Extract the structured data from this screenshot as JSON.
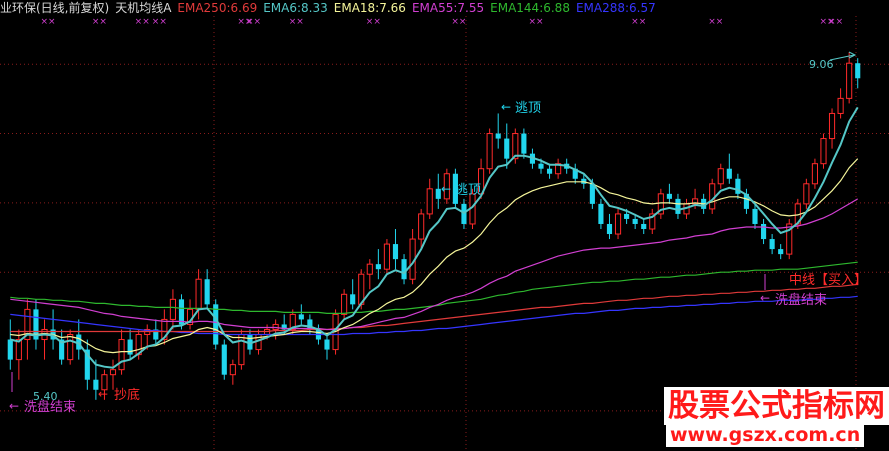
{
  "header": {
    "title": "业环保(日线,前复权)",
    "indicator": "天机均线A",
    "ema250": "EMA250:6.69",
    "ema6": "EMA6:8.33",
    "ema18": "EMA18:7.66",
    "ema55": "EMA55:7.55",
    "ema144": "EMA144:6.88",
    "ema288": "EMA288:6.57"
  },
  "annotations": {
    "high_price": "9.06",
    "low_price": "5.40",
    "escape_top_1": "逃顶",
    "escape_top_2": "逃顶",
    "buy_bottom": "抄底",
    "washout_end_1": "洗盘结束",
    "washout_end_2": "洗盘结束",
    "mid_line": "中线【买入】",
    "cross_mark": "×"
  },
  "watermark": {
    "line1": "股票公式指标网",
    "line2": "www.gszx.com.cn"
  },
  "colors": {
    "background": "#000000",
    "up": "#ff2a2a",
    "down": "#21d6ee",
    "ema6": "#55c7c7",
    "ema18": "#f5f59a",
    "ema55": "#d13fd1",
    "ema144": "#2eb82e",
    "ema250": "#e03a3a",
    "ema288": "#3535ff",
    "grid": "#8a1c1c"
  },
  "chart_data": {
    "type": "candlestick",
    "ylim": [
      5.2,
      9.4
    ],
    "y_gridlines": [
      5.49,
      6.87,
      7.56,
      8.25,
      8.94
    ],
    "ohlc": [
      [
        6.2,
        6.4,
        5.9,
        6.0
      ],
      [
        6.0,
        6.3,
        5.8,
        6.2
      ],
      [
        6.2,
        6.6,
        6.0,
        6.5
      ],
      [
        6.5,
        6.6,
        6.1,
        6.2
      ],
      [
        6.2,
        6.4,
        6.0,
        6.3
      ],
      [
        6.3,
        6.5,
        6.1,
        6.2
      ],
      [
        6.2,
        6.3,
        5.95,
        6.0
      ],
      [
        6.0,
        6.3,
        5.95,
        6.25
      ],
      [
        6.25,
        6.4,
        6.0,
        6.1
      ],
      [
        6.1,
        6.2,
        5.7,
        5.8
      ],
      [
        5.8,
        6.0,
        5.6,
        5.7
      ],
      [
        5.7,
        5.9,
        5.6,
        5.85
      ],
      [
        5.85,
        6.0,
        5.7,
        5.9
      ],
      [
        5.9,
        6.3,
        5.85,
        6.2
      ],
      [
        6.2,
        6.3,
        6.0,
        6.05
      ],
      [
        6.05,
        6.3,
        6.0,
        6.25
      ],
      [
        6.25,
        6.35,
        6.1,
        6.3
      ],
      [
        6.3,
        6.4,
        6.15,
        6.2
      ],
      [
        6.2,
        6.5,
        6.15,
        6.4
      ],
      [
        6.4,
        6.7,
        6.3,
        6.6
      ],
      [
        6.6,
        6.65,
        6.3,
        6.35
      ],
      [
        6.35,
        6.6,
        6.3,
        6.5
      ],
      [
        6.5,
        6.9,
        6.4,
        6.8
      ],
      [
        6.8,
        6.9,
        6.5,
        6.55
      ],
      [
        6.55,
        6.6,
        6.1,
        6.15
      ],
      [
        6.15,
        6.2,
        5.8,
        5.85
      ],
      [
        5.85,
        6.0,
        5.75,
        5.95
      ],
      [
        5.95,
        6.3,
        5.9,
        6.25
      ],
      [
        6.25,
        6.3,
        6.05,
        6.1
      ],
      [
        6.1,
        6.3,
        6.05,
        6.25
      ],
      [
        6.25,
        6.35,
        6.2,
        6.3
      ],
      [
        6.3,
        6.4,
        6.2,
        6.35
      ],
      [
        6.35,
        6.45,
        6.25,
        6.3
      ],
      [
        6.3,
        6.5,
        6.25,
        6.45
      ],
      [
        6.45,
        6.55,
        6.35,
        6.4
      ],
      [
        6.4,
        6.45,
        6.25,
        6.3
      ],
      [
        6.3,
        6.35,
        6.15,
        6.2
      ],
      [
        6.2,
        6.25,
        6.0,
        6.1
      ],
      [
        6.1,
        6.5,
        6.05,
        6.45
      ],
      [
        6.45,
        6.7,
        6.4,
        6.65
      ],
      [
        6.65,
        6.8,
        6.5,
        6.55
      ],
      [
        6.55,
        6.9,
        6.5,
        6.85
      ],
      [
        6.85,
        7.0,
        6.7,
        6.95
      ],
      [
        6.95,
        7.1,
        6.8,
        6.9
      ],
      [
        6.9,
        7.2,
        6.85,
        7.15
      ],
      [
        7.15,
        7.3,
        6.9,
        7.0
      ],
      [
        7.0,
        7.05,
        6.75,
        6.8
      ],
      [
        6.8,
        7.3,
        6.75,
        7.2
      ],
      [
        7.2,
        7.5,
        7.1,
        7.45
      ],
      [
        7.45,
        7.8,
        7.4,
        7.7
      ],
      [
        7.7,
        7.85,
        7.5,
        7.6
      ],
      [
        7.6,
        7.9,
        7.55,
        7.85
      ],
      [
        7.85,
        7.9,
        7.5,
        7.55
      ],
      [
        7.55,
        7.6,
        7.3,
        7.35
      ],
      [
        7.35,
        7.7,
        7.3,
        7.65
      ],
      [
        7.65,
        8.0,
        7.6,
        7.9
      ],
      [
        7.9,
        8.3,
        7.85,
        8.25
      ],
      [
        8.25,
        8.45,
        8.1,
        8.2
      ],
      [
        8.2,
        8.35,
        7.9,
        8.0
      ],
      [
        8.0,
        8.3,
        7.95,
        8.25
      ],
      [
        8.25,
        8.3,
        8.0,
        8.05
      ],
      [
        8.05,
        8.1,
        7.9,
        7.95
      ],
      [
        7.95,
        8.0,
        7.85,
        7.9
      ],
      [
        7.9,
        7.95,
        7.8,
        7.85
      ],
      [
        7.85,
        8.0,
        7.8,
        7.95
      ],
      [
        7.95,
        8.0,
        7.85,
        7.9
      ],
      [
        7.9,
        7.95,
        7.75,
        7.8
      ],
      [
        7.8,
        7.85,
        7.7,
        7.75
      ],
      [
        7.75,
        7.8,
        7.5,
        7.55
      ],
      [
        7.55,
        7.6,
        7.3,
        7.35
      ],
      [
        7.35,
        7.45,
        7.2,
        7.25
      ],
      [
        7.25,
        7.5,
        7.2,
        7.45
      ],
      [
        7.45,
        7.5,
        7.35,
        7.4
      ],
      [
        7.4,
        7.45,
        7.3,
        7.35
      ],
      [
        7.35,
        7.4,
        7.25,
        7.3
      ],
      [
        7.3,
        7.5,
        7.25,
        7.45
      ],
      [
        7.45,
        7.7,
        7.4,
        7.65
      ],
      [
        7.65,
        7.75,
        7.55,
        7.6
      ],
      [
        7.6,
        7.65,
        7.4,
        7.45
      ],
      [
        7.45,
        7.6,
        7.4,
        7.55
      ],
      [
        7.55,
        7.7,
        7.5,
        7.6
      ],
      [
        7.6,
        7.65,
        7.45,
        7.5
      ],
      [
        7.5,
        7.8,
        7.45,
        7.75
      ],
      [
        7.75,
        7.95,
        7.7,
        7.9
      ],
      [
        7.9,
        8.05,
        7.75,
        7.8
      ],
      [
        7.8,
        7.85,
        7.6,
        7.65
      ],
      [
        7.65,
        7.7,
        7.45,
        7.5
      ],
      [
        7.5,
        7.55,
        7.3,
        7.35
      ],
      [
        7.35,
        7.4,
        7.15,
        7.2
      ],
      [
        7.2,
        7.25,
        7.05,
        7.1
      ],
      [
        7.1,
        7.15,
        7.0,
        7.05
      ],
      [
        7.05,
        7.4,
        7.0,
        7.35
      ],
      [
        7.35,
        7.6,
        7.3,
        7.55
      ],
      [
        7.55,
        7.8,
        7.5,
        7.75
      ],
      [
        7.75,
        8.0,
        7.7,
        7.95
      ],
      [
        7.95,
        8.25,
        7.9,
        8.2
      ],
      [
        8.2,
        8.5,
        8.1,
        8.45
      ],
      [
        8.45,
        8.7,
        8.4,
        8.6
      ],
      [
        8.6,
        9.06,
        8.55,
        8.95
      ],
      [
        8.95,
        9.0,
        8.7,
        8.8
      ]
    ],
    "ema6": [
      6.2,
      6.18,
      6.25,
      6.24,
      6.25,
      6.24,
      6.17,
      6.19,
      6.16,
      6.05,
      5.95,
      5.93,
      5.92,
      5.98,
      6.0,
      6.06,
      6.13,
      6.15,
      6.22,
      6.33,
      6.34,
      6.38,
      6.5,
      6.51,
      6.41,
      6.25,
      6.17,
      6.19,
      6.16,
      6.19,
      6.22,
      6.26,
      6.27,
      6.32,
      6.34,
      6.33,
      6.3,
      6.24,
      6.3,
      6.4,
      6.44,
      6.56,
      6.67,
      6.73,
      6.85,
      6.89,
      6.86,
      6.96,
      7.1,
      7.28,
      7.37,
      7.5,
      7.51,
      7.46,
      7.52,
      7.63,
      7.81,
      7.92,
      7.94,
      8.03,
      8.03,
      8.01,
      7.98,
      7.94,
      7.94,
      7.93,
      7.89,
      7.85,
      7.76,
      7.64,
      7.53,
      7.51,
      7.48,
      7.44,
      7.4,
      7.42,
      7.49,
      7.51,
      7.49,
      7.51,
      7.54,
      7.53,
      7.59,
      7.68,
      7.71,
      7.69,
      7.64,
      7.55,
      7.45,
      7.35,
      7.26,
      7.29,
      7.36,
      7.47,
      7.61,
      7.77,
      7.96,
      8.14,
      8.37,
      8.51
    ],
    "ema18": [
      6.25,
      6.24,
      6.26,
      6.25,
      6.26,
      6.25,
      6.22,
      6.23,
      6.21,
      6.16,
      6.11,
      6.08,
      6.07,
      6.08,
      6.08,
      6.1,
      6.13,
      6.14,
      6.17,
      6.21,
      6.23,
      6.25,
      6.3,
      6.32,
      6.3,
      6.25,
      6.22,
      6.22,
      6.21,
      6.22,
      6.23,
      6.24,
      6.25,
      6.27,
      6.28,
      6.28,
      6.27,
      6.26,
      6.28,
      6.32,
      6.35,
      6.4,
      6.46,
      6.5,
      6.56,
      6.6,
      6.62,
      6.67,
      6.75,
      6.85,
      6.93,
      7.02,
      7.08,
      7.11,
      7.17,
      7.25,
      7.36,
      7.45,
      7.51,
      7.59,
      7.64,
      7.68,
      7.71,
      7.73,
      7.75,
      7.77,
      7.77,
      7.77,
      7.75,
      7.71,
      7.66,
      7.64,
      7.61,
      7.59,
      7.56,
      7.55,
      7.56,
      7.56,
      7.55,
      7.55,
      7.56,
      7.55,
      7.57,
      7.6,
      7.62,
      7.62,
      7.6,
      7.57,
      7.53,
      7.48,
      7.44,
      7.43,
      7.44,
      7.47,
      7.52,
      7.6,
      7.68,
      7.78,
      7.91,
      8.0
    ],
    "ema55": [
      6.6,
      6.59,
      6.58,
      6.57,
      6.56,
      6.55,
      6.54,
      6.53,
      6.52,
      6.5,
      6.48,
      6.46,
      6.45,
      6.43,
      6.42,
      6.41,
      6.4,
      6.39,
      6.38,
      6.38,
      6.38,
      6.37,
      6.38,
      6.38,
      6.37,
      6.35,
      6.34,
      6.33,
      6.32,
      6.32,
      6.32,
      6.32,
      6.31,
      6.31,
      6.31,
      6.31,
      6.31,
      6.3,
      6.3,
      6.31,
      6.32,
      6.33,
      6.35,
      6.37,
      6.39,
      6.41,
      6.42,
      6.45,
      6.48,
      6.52,
      6.55,
      6.59,
      6.62,
      6.64,
      6.67,
      6.71,
      6.76,
      6.8,
      6.83,
      6.88,
      6.91,
      6.94,
      6.97,
      7.0,
      7.03,
      7.05,
      7.07,
      7.09,
      7.1,
      7.11,
      7.11,
      7.12,
      7.13,
      7.14,
      7.15,
      7.16,
      7.17,
      7.19,
      7.2,
      7.21,
      7.23,
      7.24,
      7.25,
      7.28,
      7.3,
      7.31,
      7.32,
      7.32,
      7.32,
      7.31,
      7.31,
      7.32,
      7.33,
      7.35,
      7.38,
      7.41,
      7.45,
      7.5,
      7.55,
      7.6
    ],
    "ema144": [
      6.62,
      6.61,
      6.61,
      6.6,
      6.6,
      6.59,
      6.59,
      6.58,
      6.58,
      6.57,
      6.56,
      6.56,
      6.55,
      6.54,
      6.54,
      6.53,
      6.53,
      6.52,
      6.52,
      6.52,
      6.51,
      6.51,
      6.51,
      6.51,
      6.5,
      6.5,
      6.49,
      6.49,
      6.48,
      6.48,
      6.48,
      6.48,
      6.47,
      6.47,
      6.47,
      6.47,
      6.47,
      6.46,
      6.46,
      6.46,
      6.47,
      6.47,
      6.48,
      6.48,
      6.49,
      6.5,
      6.5,
      6.51,
      6.52,
      6.53,
      6.54,
      6.56,
      6.57,
      6.58,
      6.59,
      6.6,
      6.62,
      6.64,
      6.65,
      6.67,
      6.68,
      6.7,
      6.71,
      6.72,
      6.73,
      6.74,
      6.75,
      6.76,
      6.77,
      6.77,
      6.78,
      6.78,
      6.79,
      6.8,
      6.8,
      6.81,
      6.82,
      6.82,
      6.83,
      6.84,
      6.84,
      6.85,
      6.86,
      6.87,
      6.87,
      6.88,
      6.88,
      6.89,
      6.89,
      6.89,
      6.9,
      6.9,
      6.9,
      6.91,
      6.92,
      6.93,
      6.94,
      6.95,
      6.96,
      6.97
    ],
    "ema250": [
      6.28,
      6.28,
      6.28,
      6.28,
      6.28,
      6.28,
      6.28,
      6.28,
      6.28,
      6.28,
      6.28,
      6.28,
      6.28,
      6.28,
      6.28,
      6.28,
      6.28,
      6.28,
      6.28,
      6.28,
      6.28,
      6.28,
      6.28,
      6.28,
      6.28,
      6.28,
      6.28,
      6.28,
      6.28,
      6.28,
      6.28,
      6.29,
      6.29,
      6.29,
      6.29,
      6.3,
      6.3,
      6.3,
      6.31,
      6.31,
      6.32,
      6.32,
      6.33,
      6.34,
      6.34,
      6.35,
      6.36,
      6.37,
      6.38,
      6.39,
      6.4,
      6.41,
      6.42,
      6.43,
      6.44,
      6.45,
      6.46,
      6.47,
      6.48,
      6.49,
      6.5,
      6.51,
      6.52,
      6.52,
      6.53,
      6.54,
      6.55,
      6.56,
      6.56,
      6.57,
      6.58,
      6.59,
      6.59,
      6.6,
      6.61,
      6.61,
      6.62,
      6.63,
      6.63,
      6.64,
      6.64,
      6.65,
      6.65,
      6.66,
      6.66,
      6.67,
      6.67,
      6.68,
      6.68,
      6.69,
      6.69,
      6.7,
      6.7,
      6.71,
      6.71,
      6.72,
      6.73,
      6.73,
      6.74,
      6.75
    ],
    "ema288": [
      6.45,
      6.44,
      6.43,
      6.42,
      6.41,
      6.4,
      6.39,
      6.38,
      6.37,
      6.36,
      6.35,
      6.34,
      6.33,
      6.32,
      6.31,
      6.3,
      6.29,
      6.29,
      6.28,
      6.28,
      6.27,
      6.27,
      6.26,
      6.26,
      6.26,
      6.25,
      6.25,
      6.25,
      6.25,
      6.25,
      6.25,
      6.25,
      6.25,
      6.25,
      6.25,
      6.25,
      6.25,
      6.25,
      6.25,
      6.25,
      6.26,
      6.26,
      6.26,
      6.27,
      6.27,
      6.28,
      6.28,
      6.29,
      6.29,
      6.3,
      6.31,
      6.31,
      6.32,
      6.33,
      6.34,
      6.35,
      6.36,
      6.37,
      6.38,
      6.39,
      6.4,
      6.41,
      6.42,
      6.43,
      6.44,
      6.45,
      6.46,
      6.46,
      6.47,
      6.48,
      6.49,
      6.49,
      6.5,
      6.51,
      6.51,
      6.52,
      6.52,
      6.53,
      6.53,
      6.54,
      6.54,
      6.55,
      6.55,
      6.56,
      6.56,
      6.57,
      6.57,
      6.58,
      6.58,
      6.58,
      6.59,
      6.59,
      6.59,
      6.6,
      6.6,
      6.61,
      6.61,
      6.62,
      6.62,
      6.63
    ]
  }
}
